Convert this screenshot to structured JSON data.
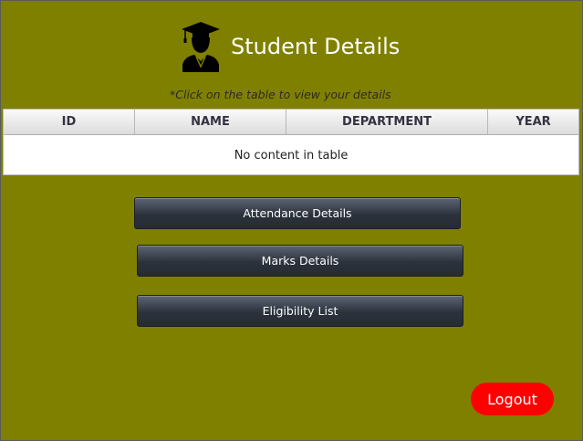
{
  "header": {
    "title": "Student Details",
    "icon": "graduate-icon",
    "hint": "*Click on the table to view your details"
  },
  "table": {
    "columns": [
      "ID",
      "NAME",
      "DEPARTMENT",
      "YEAR"
    ],
    "empty_message": "No content in table"
  },
  "actions": {
    "attendance_label": "Attendance Details",
    "marks_label": "Marks Details",
    "eligibility_label": "Eligibility List",
    "logout_label": "Logout"
  },
  "colors": {
    "background": "#808000",
    "logout": "#ff0000",
    "button": "#2c323c"
  }
}
